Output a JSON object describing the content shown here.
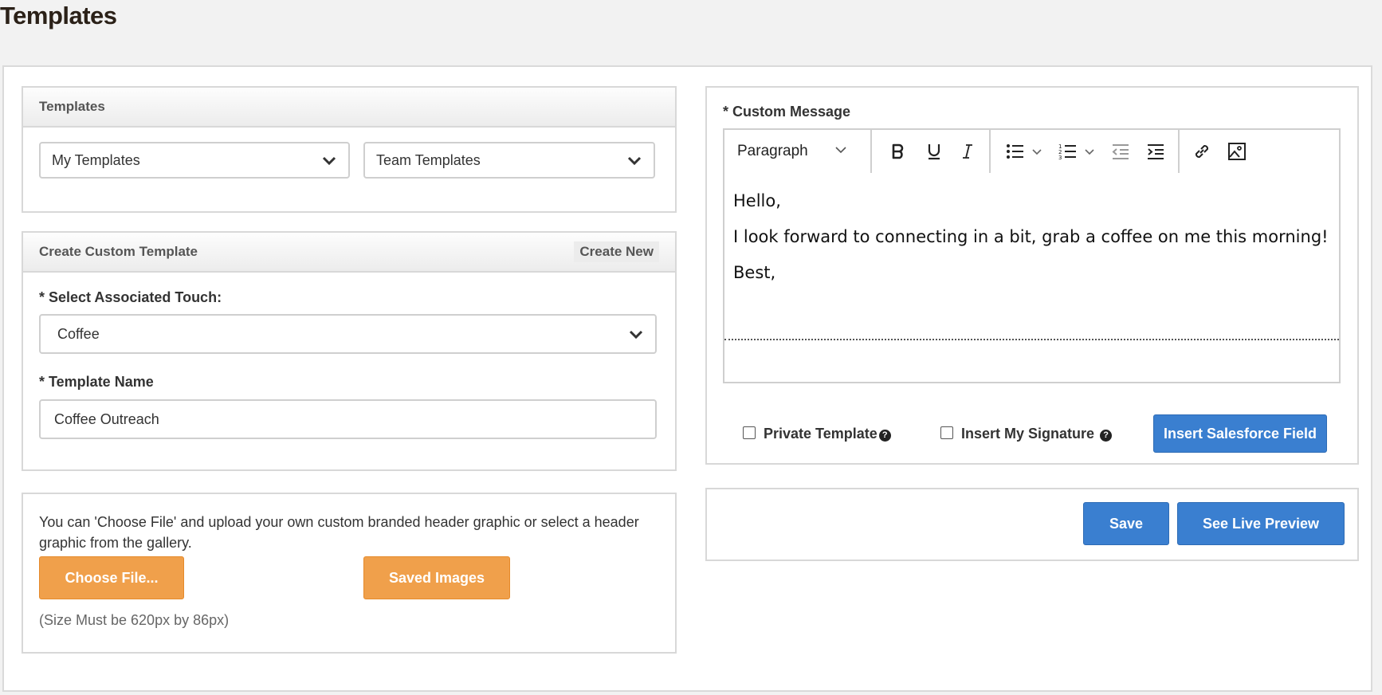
{
  "page": {
    "title": "Templates"
  },
  "templates_panel": {
    "header": "Templates",
    "my_templates": "My Templates",
    "team_templates": "Team Templates"
  },
  "create_panel": {
    "header": "Create Custom Template",
    "create_new": "Create New",
    "touch_label": "* Select Associated Touch:",
    "touch_value": "Coffee",
    "name_label": "* Template Name",
    "name_value": "Coffee Outreach"
  },
  "upload_panel": {
    "help_text": "You can 'Choose File' and upload your own custom branded header graphic or select a header graphic from the gallery.",
    "choose_file": "Choose File...",
    "saved_images": "Saved Images",
    "size_note": "(Size Must be 620px by 86px)"
  },
  "message_panel": {
    "label": "* Custom Message",
    "format_select": "Paragraph",
    "body": [
      "Hello,",
      "I look forward to connecting in a bit, grab a coffee on me this morning!",
      "Best,"
    ],
    "private_template": "Private Template",
    "insert_signature": "Insert My Signature",
    "insert_salesforce": "Insert Salesforce Field"
  },
  "actions": {
    "save": "Save",
    "live_preview": "See Live Preview"
  },
  "icons": [
    "chevron-down-icon",
    "bold-icon",
    "underline-icon",
    "italic-icon",
    "bullet-list-icon",
    "numbered-list-icon",
    "outdent-icon",
    "indent-icon",
    "link-icon",
    "image-icon",
    "help-icon"
  ],
  "colors": {
    "orange": "#f0a04b",
    "blue": "#3a7fd0",
    "title": "#2b2118"
  }
}
